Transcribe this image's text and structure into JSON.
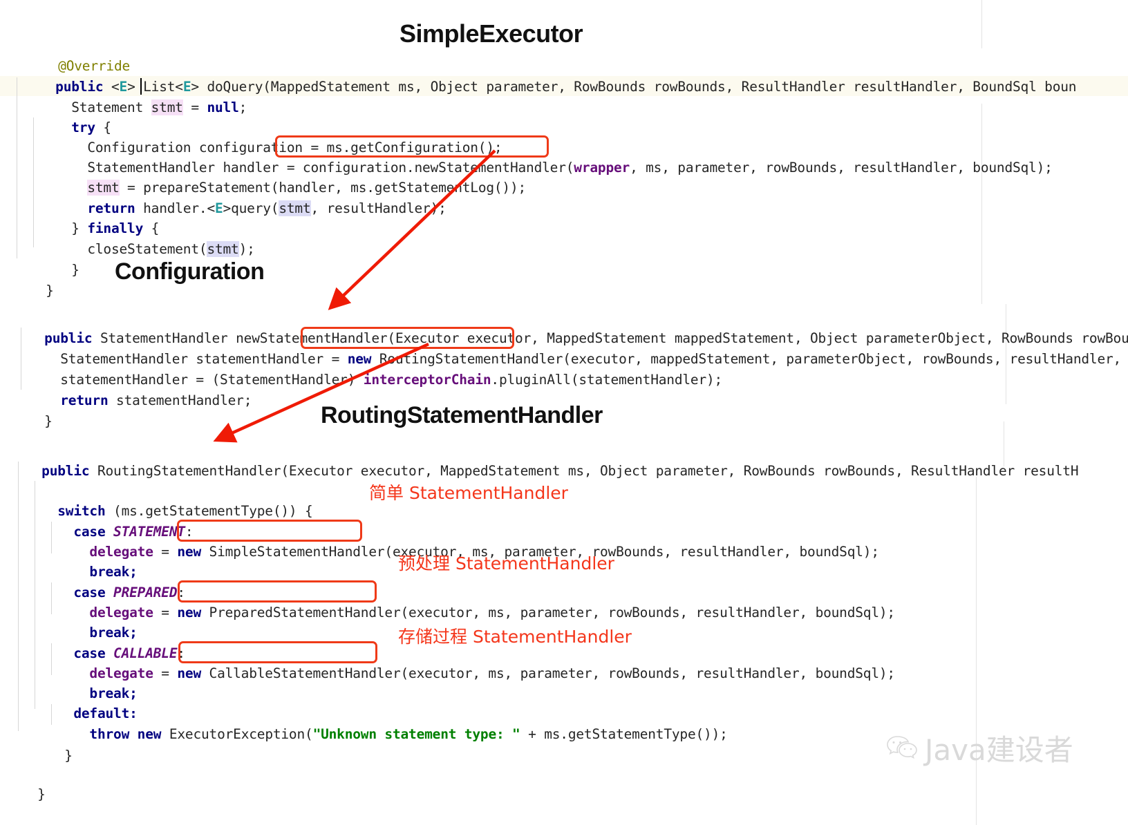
{
  "document": {
    "type": "annotated-code-screenshot",
    "language": "java",
    "topic": "MyBatis StatementHandler creation flow"
  },
  "sections": [
    {
      "id": "simple-executor",
      "title": "SimpleExecutor"
    },
    {
      "id": "configuration",
      "title": "Configuration"
    },
    {
      "id": "routing-statement-handler",
      "title": "RoutingStatementHandler"
    }
  ],
  "code": {
    "simple_executor": {
      "l1": "@Override",
      "l2_a": "public",
      "l2_b": " <",
      "l2_c": "E",
      "l2_d": "> List<",
      "l2_e": "E",
      "l2_f": "> doQuery(MappedStatement ms, Object parameter, RowBounds rowBounds, ResultHandler resultHandler, BoundSql boun",
      "l3_a": "  Statement ",
      "l3_b": "stmt",
      "l3_c": " = ",
      "l3_d": "null",
      "l3_e": ";",
      "l4_a": "  try",
      "l4_b": " {",
      "l5": "    Configuration configuration = ms.getConfiguration();",
      "l6_a": "    StatementHandler handler = configuration.newStatementHandler(",
      "l6_b": "wrapper",
      "l6_c": ", ms, parameter, rowBounds, resultHandler, boundSql);",
      "l7_a": "    ",
      "l7_b": "stmt",
      "l7_c": " = prepareStatement(handler, ms.getStatementLog());",
      "l8_a": "    ",
      "l8_b": "return",
      "l8_c": " handler.<",
      "l8_d": "E",
      "l8_e": ">query(",
      "l8_f": "stmt",
      "l8_g": ", resultHandler);",
      "l9_a": "  } ",
      "l9_b": "finally",
      "l9_c": " {",
      "l10_a": "    closeStatement(",
      "l10_b": "stmt",
      "l10_c": ");",
      "l11": "  }",
      "l12": "}"
    },
    "configuration": {
      "l1_a": "public",
      "l1_b": " StatementHandler newStatementHandler(Executor executor, MappedStatement mappedStatement, Object parameterObject, RowBounds rowBoun",
      "l2_a": "  StatementHandler statementHandler = ",
      "l2_b": "new",
      "l2_c": " RoutingStatementHandler(executor, mappedStatement, parameterObject, rowBounds, resultHandler, b",
      "l3_a": "  statementHandler = (StatementHandler) ",
      "l3_b": "interceptorChain",
      "l3_c": ".pluginAll(statementHandler);",
      "l4_a": "  ",
      "l4_b": "return",
      "l4_c": " statementHandler;",
      "l5": "}"
    },
    "routing": {
      "l1_a": "public",
      "l1_b": " RoutingStatementHandler(Executor executor, MappedStatement ms, Object parameter, RowBounds rowBounds, ResultHandler resultH",
      "l2_a": "  switch",
      "l2_b": " (ms.getStatementType()) {",
      "l3_a": "    case ",
      "l3_b": "STATEMENT",
      "l3_c": ":",
      "l4_a": "      delegate",
      "l4_b": " = ",
      "l4_c": "new",
      "l4_d": " SimpleStatementHandler(executor, ms, parameter, rowBounds, resultHandler, boundSql);",
      "l5": "      break;",
      "l6_a": "    case ",
      "l6_b": "PREPARED",
      "l6_c": ":",
      "l7_a": "      delegate",
      "l7_b": " = ",
      "l7_c": "new",
      "l7_d": " PreparedStatementHandler(executor, ms, parameter, rowBounds, resultHandler, boundSql);",
      "l8": "      break;",
      "l9_a": "    case ",
      "l9_b": "CALLABLE",
      "l9_c": ":",
      "l10_a": "      delegate",
      "l10_b": " = ",
      "l10_c": "new",
      "l10_d": " CallableStatementHandler(executor, ms, parameter, rowBounds, resultHandler, boundSql);",
      "l11": "      break;",
      "l12": "    default:",
      "l13_a": "      ",
      "l13_b": "throw new",
      "l13_c": " ExecutorException(",
      "l13_d": "\"Unknown statement type: \"",
      "l13_e": " + ms.getStatementType());",
      "l14": "  }",
      "l15": "}"
    }
  },
  "annotations": {
    "simple": "简单 StatementHandler",
    "prepared": "预处理 StatementHandler",
    "callable": "存储过程 StatementHandler"
  },
  "highlight_boxes": [
    {
      "name": "box-new-statement-handler",
      "target": "configuration.newStatementHandler"
    },
    {
      "name": "box-new-routing-statement-handler",
      "target": "new RoutingStatementHandler"
    },
    {
      "name": "box-simple-statement-handler",
      "target": "SimpleStatementHandler"
    },
    {
      "name": "box-prepared-statement-handler",
      "target": "PreparedStatementHandler"
    },
    {
      "name": "box-callable-statement-handler",
      "target": "CallableStatementHandler"
    }
  ],
  "arrows": [
    {
      "name": "arrow-to-configuration",
      "from": "configuration.newStatementHandler",
      "to": "Configuration.newStatementHandler declaration"
    },
    {
      "name": "arrow-to-routing",
      "from": "new RoutingStatementHandler",
      "to": "RoutingStatementHandler constructor"
    }
  ],
  "watermark": {
    "icon": "wechat-icon",
    "text": "Java建设者"
  },
  "colors": {
    "accent_red": "#ef3a18",
    "note_red": "#f4361b",
    "keyword_blue": "#000080",
    "generic_teal": "#20999d",
    "field_purple": "#660e7a",
    "string_green": "#008000",
    "annotation_olive": "#808000",
    "line_highlight": "#fcfaef",
    "watermark_gray": "#d9d9d9"
  }
}
